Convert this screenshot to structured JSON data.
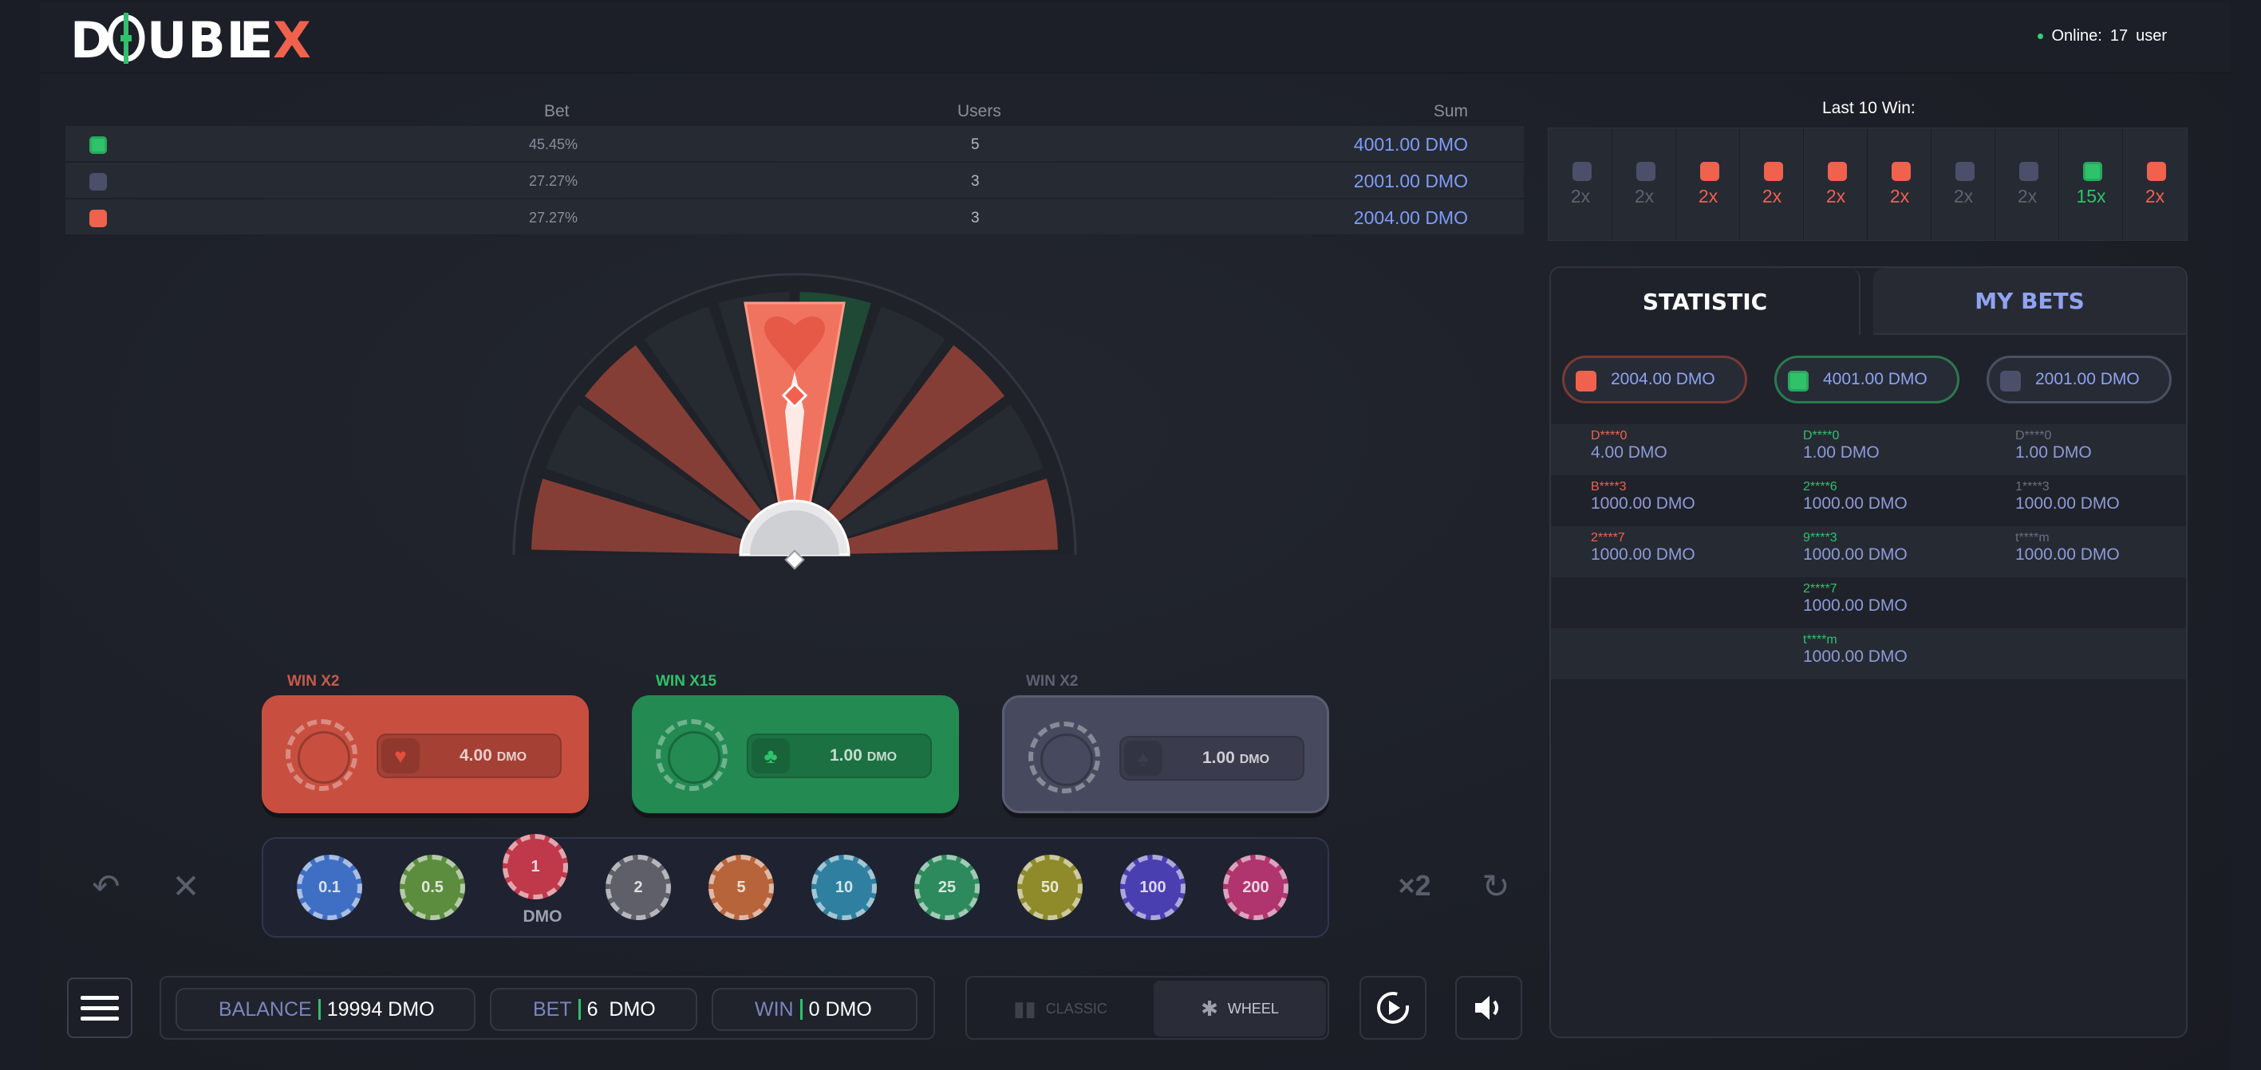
{
  "header": {
    "logo_text": "DOUBLEX",
    "online_label": "Online:",
    "online_count": "17",
    "online_unit": "user"
  },
  "bet_table": {
    "headers": {
      "bet": "Bet",
      "users": "Users",
      "sum": "Sum"
    },
    "rows": [
      {
        "color": "green",
        "percent": "45.45%",
        "users": "5",
        "sum": "4001.00 DMO"
      },
      {
        "color": "grey",
        "percent": "27.27%",
        "users": "3",
        "sum": "2001.00 DMO"
      },
      {
        "color": "red",
        "percent": "27.27%",
        "users": "3",
        "sum": "2004.00 DMO"
      }
    ]
  },
  "bet_boxes": [
    {
      "label": "WIN X2",
      "suit": "heart-icon",
      "amount": "4.00",
      "unit": "DMO",
      "color": "#c84f40"
    },
    {
      "label": "WIN X15",
      "suit": "clover-icon",
      "amount": "1.00",
      "unit": "DMO",
      "color": "#238a52"
    },
    {
      "label": "WIN X2",
      "suit": "spade-icon",
      "amount": "1.00",
      "unit": "DMO",
      "color": "#474a5e"
    }
  ],
  "chips": [
    {
      "value": "0.1",
      "color": "#3f6fc4"
    },
    {
      "value": "0.5",
      "color": "#5c8c3e"
    },
    {
      "value": "1",
      "color": "#c0394a"
    },
    {
      "value": "2",
      "color": "#5e5f68"
    },
    {
      "value": "5",
      "color": "#b8643a"
    },
    {
      "value": "10",
      "color": "#2f7fa0"
    },
    {
      "value": "25",
      "color": "#2d8a5c"
    },
    {
      "value": "50",
      "color": "#8f8a2a"
    },
    {
      "value": "100",
      "color": "#4a3fb0"
    },
    {
      "value": "200",
      "color": "#b0346e"
    }
  ],
  "chip_currency": "DMO",
  "multiply_label": "×2",
  "bottom": {
    "balance_label": "BALANCE",
    "balance_value": "19994 DMO",
    "bet_label": "BET",
    "bet_value": "6  DMO",
    "win_label": "WIN",
    "win_value": "0 DMO",
    "mode_classic": "CLASSIC",
    "mode_wheel": "WHEEL"
  },
  "last10": {
    "title": "Last 10 Win:",
    "items": [
      {
        "color": "grey",
        "mult": "2x"
      },
      {
        "color": "grey",
        "mult": "2x"
      },
      {
        "color": "red",
        "mult": "2x"
      },
      {
        "color": "red",
        "mult": "2x"
      },
      {
        "color": "red",
        "mult": "2x"
      },
      {
        "color": "red",
        "mult": "2x"
      },
      {
        "color": "grey",
        "mult": "2x"
      },
      {
        "color": "grey",
        "mult": "2x"
      },
      {
        "color": "green",
        "mult": "15x"
      },
      {
        "color": "red",
        "mult": "2x"
      }
    ]
  },
  "stats_panel": {
    "tab_statistic": "STATISTIC",
    "tab_my_bets": "MY BETS",
    "totals": [
      {
        "color": "red",
        "value": "2004.00 DMO"
      },
      {
        "color": "green",
        "value": "4001.00 DMO"
      },
      {
        "color": "grey",
        "value": "2001.00 DMO"
      }
    ],
    "columns": [
      [
        {
          "name": "D****0",
          "amount": "4.00 DMO"
        },
        {
          "name": "B****3",
          "amount": "1000.00 DMO"
        },
        {
          "name": "2****7",
          "amount": "1000.00 DMO"
        }
      ],
      [
        {
          "name": "D****0",
          "amount": "1.00 DMO"
        },
        {
          "name": "2****6",
          "amount": "1000.00 DMO"
        },
        {
          "name": "9****3",
          "amount": "1000.00 DMO"
        },
        {
          "name": "2****7",
          "amount": "1000.00 DMO"
        },
        {
          "name": "t****m",
          "amount": "1000.00 DMO"
        }
      ],
      [
        {
          "name": "D****0",
          "amount": "1.00 DMO"
        },
        {
          "name": "1****3",
          "amount": "1000.00 DMO"
        },
        {
          "name": "t****m",
          "amount": "1000.00 DMO"
        }
      ]
    ]
  },
  "colors": {
    "red": "#f0624d",
    "green": "#2fc26b",
    "grey": "#4b4f6a",
    "accent_blue": "#7f9cf5"
  }
}
